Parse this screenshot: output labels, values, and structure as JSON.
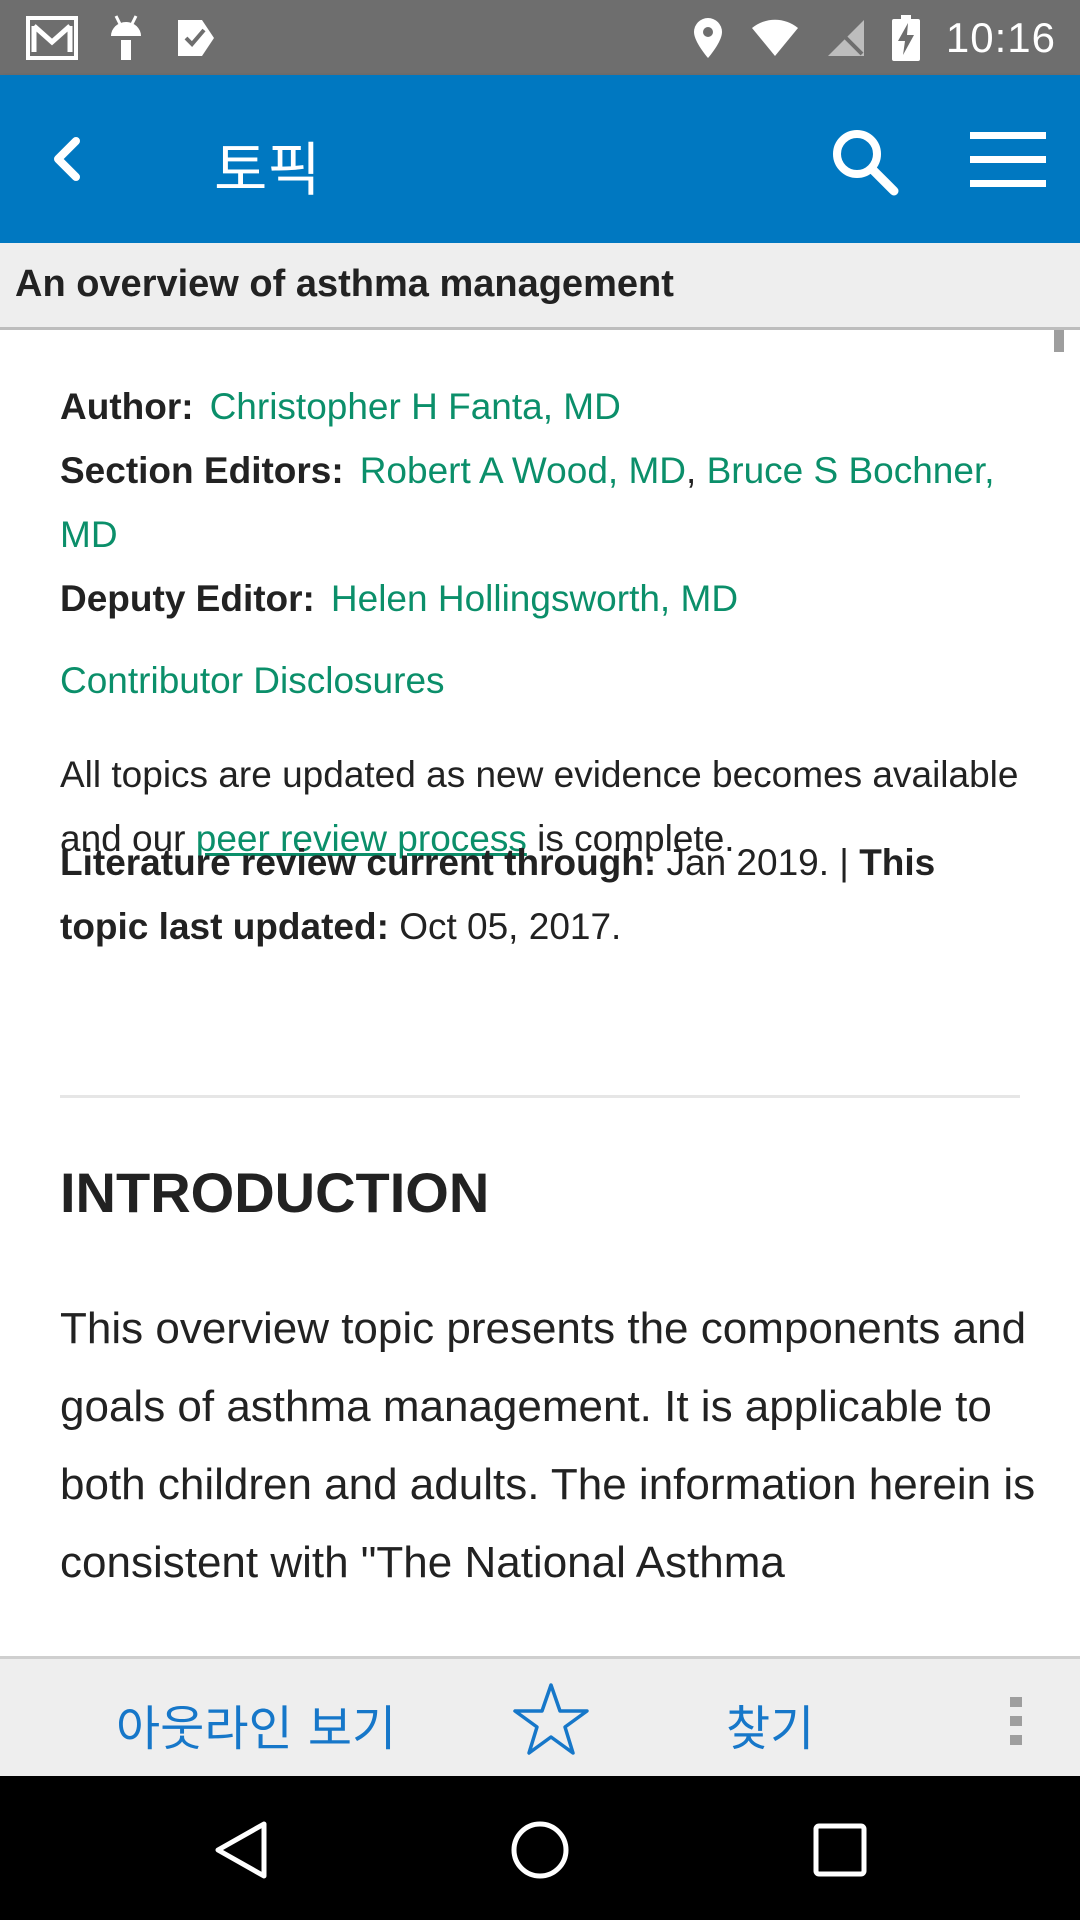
{
  "status_bar": {
    "time": "10:16",
    "icons": [
      "gmail-icon",
      "android-debug-icon",
      "play-store-icon",
      "location-icon",
      "wifi-icon",
      "no-sim-icon",
      "battery-charging-icon"
    ]
  },
  "app_bar": {
    "title": "토픽",
    "icons": [
      "back-icon",
      "search-icon",
      "menu-icon"
    ]
  },
  "topic": {
    "title": "An overview of asthma management"
  },
  "meta": {
    "author_label": "Author:",
    "author": "Christopher H Fanta, MD",
    "section_editors_label": "Section Editors:",
    "section_editor_1": "Robert A Wood, MD",
    "section_editor_sep": ",",
    "section_editor_2": "Bruce S Bochner, MD",
    "deputy_editor_label": "Deputy Editor:",
    "deputy_editor": "Helen Hollingsworth, MD",
    "contributor_disclosures": "Contributor Disclosures",
    "update_note_pre": "All topics are updated as new evidence becomes available and our",
    "peer_review_link": "peer review process",
    "update_note_post": "is complete.",
    "lit_review_label": "Literature review current through:",
    "lit_review_value": "Jan 2019. |",
    "last_updated_label": "This topic last updated:",
    "last_updated_value": "Oct 05, 2017."
  },
  "introduction": {
    "heading": "INTRODUCTION",
    "body": "This overview topic presents the components and goals of asthma management. It is applicable to both children and adults. The information herein is consistent with \"The National Asthma"
  },
  "bottom_bar": {
    "outline_label": "아웃라인 보기",
    "find_label": "찾기",
    "icons": [
      "star-icon",
      "more-vert-icon"
    ]
  },
  "nav_bar": {
    "icons": [
      "nav-back-icon",
      "nav-home-icon",
      "nav-recents-icon"
    ]
  },
  "colors": {
    "app_bar": "#0078c1",
    "link_green": "#0b8f6a",
    "toolbar_blue": "#1677c9"
  }
}
